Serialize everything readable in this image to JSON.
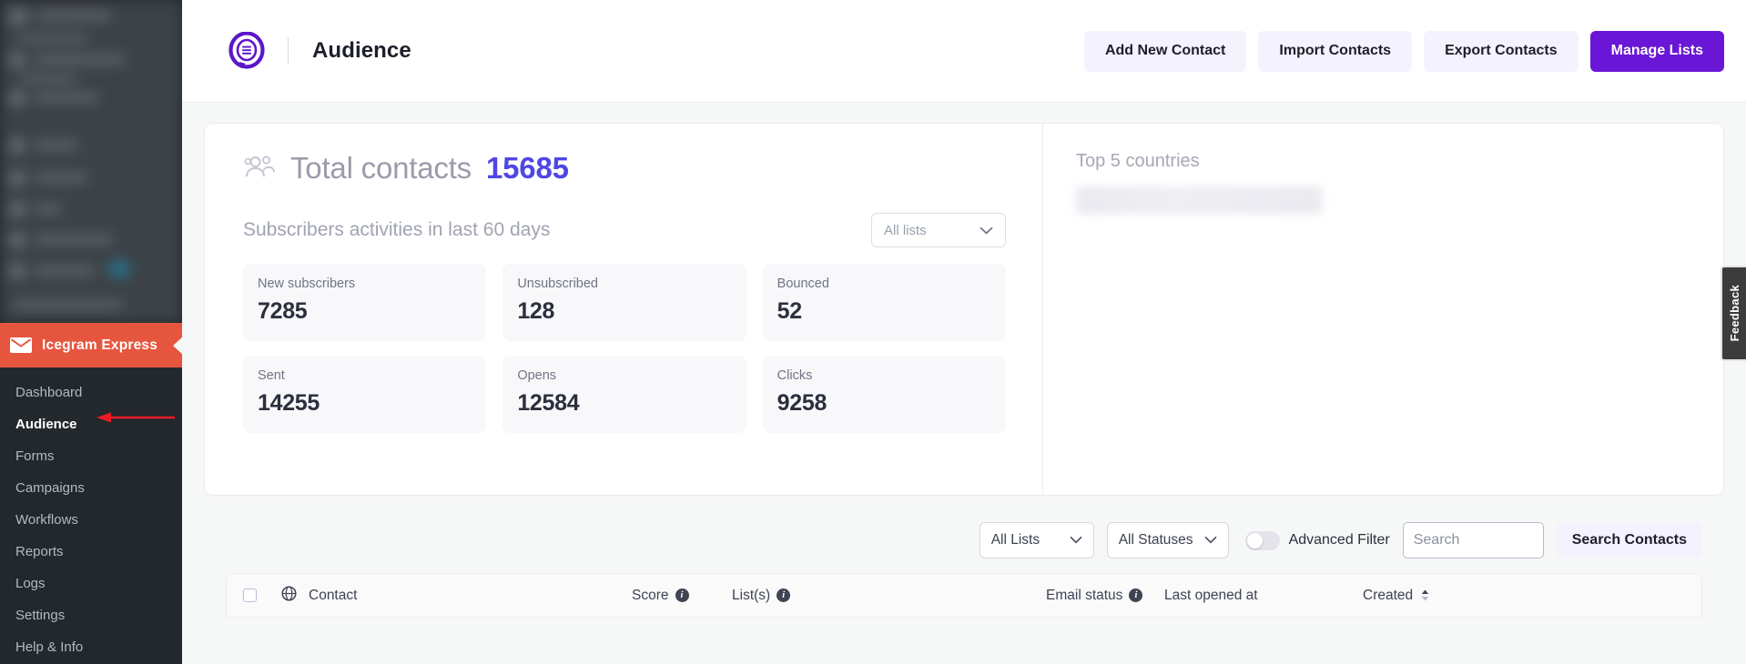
{
  "sidebar": {
    "brand": {
      "label": "Icegram Express",
      "icon": "envelope-icon",
      "bg": "#e6563f"
    },
    "items": [
      {
        "label": "Dashboard",
        "active": false
      },
      {
        "label": "Audience",
        "active": true
      },
      {
        "label": "Forms",
        "active": false
      },
      {
        "label": "Campaigns",
        "active": false
      },
      {
        "label": "Workflows",
        "active": false
      },
      {
        "label": "Reports",
        "active": false
      },
      {
        "label": "Logs",
        "active": false
      },
      {
        "label": "Settings",
        "active": false
      },
      {
        "label": "Help & Info",
        "active": false
      }
    ],
    "bg": "#23282d"
  },
  "topbar": {
    "logo_icon": "icegram-bubble-logo",
    "title": "Audience",
    "buttons": [
      {
        "label": "Add New Contact",
        "style": "light"
      },
      {
        "label": "Import Contacts",
        "style": "light"
      },
      {
        "label": "Export Contacts",
        "style": "light"
      },
      {
        "label": "Manage Lists",
        "style": "primary"
      }
    ],
    "primary_color": "#6a16d6"
  },
  "overview": {
    "people_icon": "people-group-icon",
    "total_label": "Total contacts",
    "total_value": "15685",
    "total_value_color": "#4f46e5",
    "activities_title": "Subscribers activities in last 60 days",
    "list_filter": {
      "value": "All lists",
      "icon": "chevron-down-icon"
    },
    "tiles": [
      {
        "label": "New subscribers",
        "value": "7285"
      },
      {
        "label": "Unsubscribed",
        "value": "128"
      },
      {
        "label": "Bounced",
        "value": "52"
      },
      {
        "label": "Sent",
        "value": "14255"
      },
      {
        "label": "Opens",
        "value": "12584"
      },
      {
        "label": "Clicks",
        "value": "9258"
      }
    ],
    "countries_title": "Top 5 countries"
  },
  "filters": {
    "lists": {
      "value": "All Lists",
      "icon": "chevron-down-icon"
    },
    "statuses": {
      "value": "All Statuses",
      "icon": "chevron-down-icon"
    },
    "advanced_filter_label": "Advanced Filter",
    "advanced_filter_on": false,
    "search_placeholder": "Search",
    "search_value": "",
    "search_button": "Search Contacts"
  },
  "table": {
    "globe_icon": "globe-icon",
    "columns": [
      {
        "label": "Contact",
        "info": false,
        "sortable": false
      },
      {
        "label": "Score",
        "info": true,
        "sortable": false
      },
      {
        "label": "List(s)",
        "info": true,
        "sortable": false
      },
      {
        "label": "Email status",
        "info": true,
        "sortable": false
      },
      {
        "label": "Last opened at",
        "info": false,
        "sortable": false
      },
      {
        "label": "Created",
        "info": false,
        "sortable": true
      }
    ],
    "rows": []
  },
  "feedback": {
    "label": "Feedback"
  }
}
